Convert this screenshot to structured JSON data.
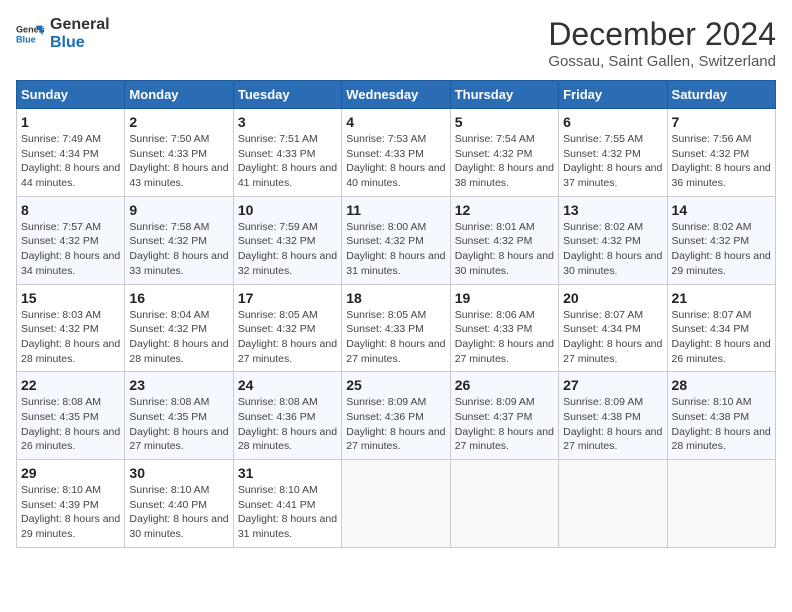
{
  "header": {
    "logo_line1": "General",
    "logo_line2": "Blue",
    "title": "December 2024",
    "subtitle": "Gossau, Saint Gallen, Switzerland"
  },
  "weekdays": [
    "Sunday",
    "Monday",
    "Tuesday",
    "Wednesday",
    "Thursday",
    "Friday",
    "Saturday"
  ],
  "weeks": [
    [
      {
        "day": "1",
        "sunrise": "Sunrise: 7:49 AM",
        "sunset": "Sunset: 4:34 PM",
        "daylight": "Daylight: 8 hours and 44 minutes."
      },
      {
        "day": "2",
        "sunrise": "Sunrise: 7:50 AM",
        "sunset": "Sunset: 4:33 PM",
        "daylight": "Daylight: 8 hours and 43 minutes."
      },
      {
        "day": "3",
        "sunrise": "Sunrise: 7:51 AM",
        "sunset": "Sunset: 4:33 PM",
        "daylight": "Daylight: 8 hours and 41 minutes."
      },
      {
        "day": "4",
        "sunrise": "Sunrise: 7:53 AM",
        "sunset": "Sunset: 4:33 PM",
        "daylight": "Daylight: 8 hours and 40 minutes."
      },
      {
        "day": "5",
        "sunrise": "Sunrise: 7:54 AM",
        "sunset": "Sunset: 4:32 PM",
        "daylight": "Daylight: 8 hours and 38 minutes."
      },
      {
        "day": "6",
        "sunrise": "Sunrise: 7:55 AM",
        "sunset": "Sunset: 4:32 PM",
        "daylight": "Daylight: 8 hours and 37 minutes."
      },
      {
        "day": "7",
        "sunrise": "Sunrise: 7:56 AM",
        "sunset": "Sunset: 4:32 PM",
        "daylight": "Daylight: 8 hours and 36 minutes."
      }
    ],
    [
      {
        "day": "8",
        "sunrise": "Sunrise: 7:57 AM",
        "sunset": "Sunset: 4:32 PM",
        "daylight": "Daylight: 8 hours and 34 minutes."
      },
      {
        "day": "9",
        "sunrise": "Sunrise: 7:58 AM",
        "sunset": "Sunset: 4:32 PM",
        "daylight": "Daylight: 8 hours and 33 minutes."
      },
      {
        "day": "10",
        "sunrise": "Sunrise: 7:59 AM",
        "sunset": "Sunset: 4:32 PM",
        "daylight": "Daylight: 8 hours and 32 minutes."
      },
      {
        "day": "11",
        "sunrise": "Sunrise: 8:00 AM",
        "sunset": "Sunset: 4:32 PM",
        "daylight": "Daylight: 8 hours and 31 minutes."
      },
      {
        "day": "12",
        "sunrise": "Sunrise: 8:01 AM",
        "sunset": "Sunset: 4:32 PM",
        "daylight": "Daylight: 8 hours and 30 minutes."
      },
      {
        "day": "13",
        "sunrise": "Sunrise: 8:02 AM",
        "sunset": "Sunset: 4:32 PM",
        "daylight": "Daylight: 8 hours and 30 minutes."
      },
      {
        "day": "14",
        "sunrise": "Sunrise: 8:02 AM",
        "sunset": "Sunset: 4:32 PM",
        "daylight": "Daylight: 8 hours and 29 minutes."
      }
    ],
    [
      {
        "day": "15",
        "sunrise": "Sunrise: 8:03 AM",
        "sunset": "Sunset: 4:32 PM",
        "daylight": "Daylight: 8 hours and 28 minutes."
      },
      {
        "day": "16",
        "sunrise": "Sunrise: 8:04 AM",
        "sunset": "Sunset: 4:32 PM",
        "daylight": "Daylight: 8 hours and 28 minutes."
      },
      {
        "day": "17",
        "sunrise": "Sunrise: 8:05 AM",
        "sunset": "Sunset: 4:32 PM",
        "daylight": "Daylight: 8 hours and 27 minutes."
      },
      {
        "day": "18",
        "sunrise": "Sunrise: 8:05 AM",
        "sunset": "Sunset: 4:33 PM",
        "daylight": "Daylight: 8 hours and 27 minutes."
      },
      {
        "day": "19",
        "sunrise": "Sunrise: 8:06 AM",
        "sunset": "Sunset: 4:33 PM",
        "daylight": "Daylight: 8 hours and 27 minutes."
      },
      {
        "day": "20",
        "sunrise": "Sunrise: 8:07 AM",
        "sunset": "Sunset: 4:34 PM",
        "daylight": "Daylight: 8 hours and 27 minutes."
      },
      {
        "day": "21",
        "sunrise": "Sunrise: 8:07 AM",
        "sunset": "Sunset: 4:34 PM",
        "daylight": "Daylight: 8 hours and 26 minutes."
      }
    ],
    [
      {
        "day": "22",
        "sunrise": "Sunrise: 8:08 AM",
        "sunset": "Sunset: 4:35 PM",
        "daylight": "Daylight: 8 hours and 26 minutes."
      },
      {
        "day": "23",
        "sunrise": "Sunrise: 8:08 AM",
        "sunset": "Sunset: 4:35 PM",
        "daylight": "Daylight: 8 hours and 27 minutes."
      },
      {
        "day": "24",
        "sunrise": "Sunrise: 8:08 AM",
        "sunset": "Sunset: 4:36 PM",
        "daylight": "Daylight: 8 hours and 28 minutes."
      },
      {
        "day": "25",
        "sunrise": "Sunrise: 8:09 AM",
        "sunset": "Sunset: 4:36 PM",
        "daylight": "Daylight: 8 hours and 27 minutes."
      },
      {
        "day": "26",
        "sunrise": "Sunrise: 8:09 AM",
        "sunset": "Sunset: 4:37 PM",
        "daylight": "Daylight: 8 hours and 27 minutes."
      },
      {
        "day": "27",
        "sunrise": "Sunrise: 8:09 AM",
        "sunset": "Sunset: 4:38 PM",
        "daylight": "Daylight: 8 hours and 27 minutes."
      },
      {
        "day": "28",
        "sunrise": "Sunrise: 8:10 AM",
        "sunset": "Sunset: 4:38 PM",
        "daylight": "Daylight: 8 hours and 28 minutes."
      }
    ],
    [
      {
        "day": "29",
        "sunrise": "Sunrise: 8:10 AM",
        "sunset": "Sunset: 4:39 PM",
        "daylight": "Daylight: 8 hours and 29 minutes."
      },
      {
        "day": "30",
        "sunrise": "Sunrise: 8:10 AM",
        "sunset": "Sunset: 4:40 PM",
        "daylight": "Daylight: 8 hours and 30 minutes."
      },
      {
        "day": "31",
        "sunrise": "Sunrise: 8:10 AM",
        "sunset": "Sunset: 4:41 PM",
        "daylight": "Daylight: 8 hours and 31 minutes."
      },
      null,
      null,
      null,
      null
    ]
  ]
}
